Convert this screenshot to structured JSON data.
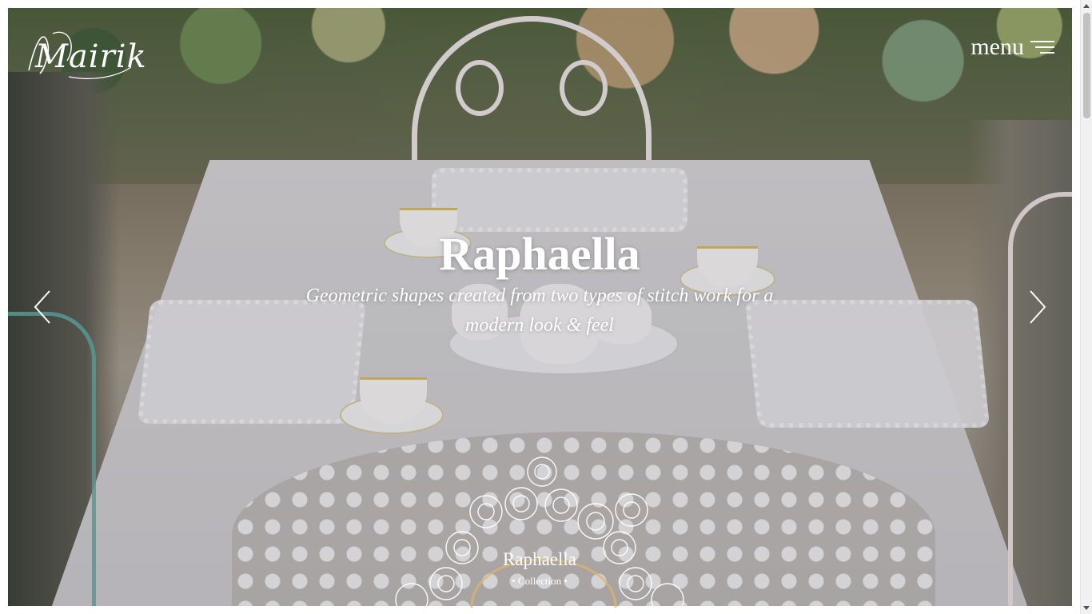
{
  "brand": {
    "logo_text": "Mairik"
  },
  "header": {
    "menu_label": "menu",
    "menu_icon": "hamburger-icon"
  },
  "hero": {
    "title": "Raphaella",
    "subtitle": "Geometric shapes created from two types of stitch work for a modern look & feel",
    "prev_icon": "chevron-left-icon",
    "next_icon": "chevron-right-icon"
  },
  "collection_badge": {
    "title": "Raphaella",
    "subtitle": "• Collection •",
    "ring_color": "#d9b56a"
  },
  "colors": {
    "text": "#ffffff",
    "accent": "#d9b56a"
  }
}
